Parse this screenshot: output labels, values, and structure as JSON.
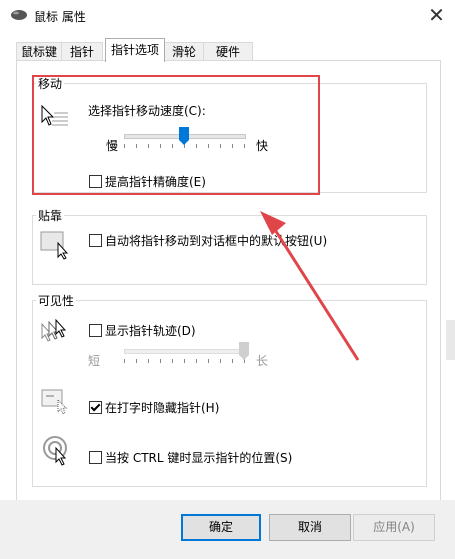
{
  "window": {
    "title": "鼠标 属性",
    "close_glyph": "✕"
  },
  "tabs": [
    {
      "label": "鼠标键",
      "active": false
    },
    {
      "label": "指针",
      "active": false
    },
    {
      "label": "指针选项",
      "active": true
    },
    {
      "label": "滑轮",
      "active": false
    },
    {
      "label": "硬件",
      "active": false
    }
  ],
  "motion": {
    "title": "移动",
    "speed_label": "选择指针移动速度(C):",
    "slow_label": "慢",
    "fast_label": "快",
    "speed_value_fraction": 0.5,
    "precision_label": "提高指针精确度(E)",
    "precision_checked": false,
    "icon": "pointer-speed-icon"
  },
  "snap": {
    "title": "贴靠",
    "snap_label": "自动将指针移动到对话框中的默认按钮(U)",
    "snap_checked": false,
    "icon": "snap-to-icon"
  },
  "visibility": {
    "title": "可见性",
    "trails_label": "显示指针轨迹(D)",
    "trails_checked": false,
    "short_label": "短",
    "long_label": "长",
    "trails_value_fraction": 1.0,
    "hide_label": "在打字时隐藏指针(H)",
    "hide_checked": true,
    "ctrl_label": "当按 CTRL 键时显示指针的位置(S)",
    "ctrl_checked": false,
    "icons": [
      "pointer-trails-icon",
      "hide-while-typing-icon",
      "ctrl-locate-icon"
    ]
  },
  "buttons": {
    "ok": "确定",
    "cancel": "取消",
    "apply": "应用(A)"
  },
  "annotation_color": "#e0454a"
}
